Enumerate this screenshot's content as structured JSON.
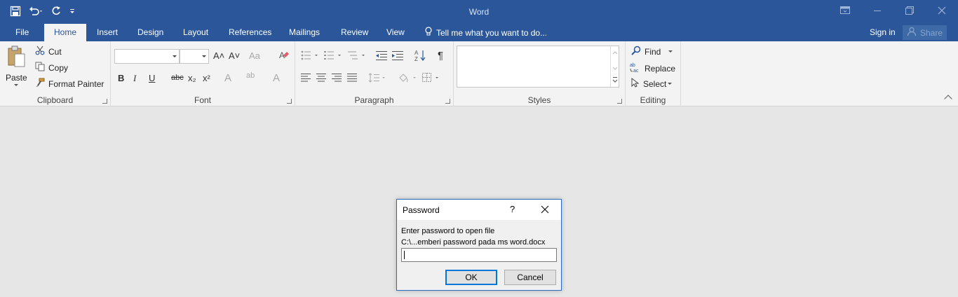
{
  "app": {
    "title": "Word"
  },
  "quick_access": {
    "icons": [
      "save-icon",
      "undo-icon",
      "redo-icon",
      "customize-icon"
    ]
  },
  "window_controls": {
    "icons": [
      "ribbon-display-icon",
      "minimize-icon",
      "restore-icon",
      "close-icon"
    ]
  },
  "tabs": [
    {
      "label": "File"
    },
    {
      "label": "Home"
    },
    {
      "label": "Insert"
    },
    {
      "label": "Design"
    },
    {
      "label": "Layout"
    },
    {
      "label": "References"
    },
    {
      "label": "Mailings"
    },
    {
      "label": "Review"
    },
    {
      "label": "View"
    }
  ],
  "active_tab": "Home",
  "tell_me": {
    "text": "Tell me what you want to do..."
  },
  "account": {
    "sign_in": "Sign in",
    "share": "Share"
  },
  "ribbon": {
    "clipboard": {
      "paste": "Paste",
      "cut": "Cut",
      "copy": "Copy",
      "format_painter": "Format Painter",
      "label": "Clipboard"
    },
    "font": {
      "label": "Font",
      "font_name": "",
      "font_size": "",
      "bold": "B",
      "italic": "I",
      "underline": "U",
      "strike": "abc",
      "subscript": "x₂",
      "superscript": "x²",
      "grow": "A˄",
      "shrink": "A˅",
      "case": "Aa",
      "text_effects": "A",
      "highlight": "ab",
      "font_color": "A"
    },
    "paragraph": {
      "label": "Paragraph",
      "pilcrow": "¶"
    },
    "styles": {
      "label": "Styles"
    },
    "editing": {
      "label": "Editing",
      "find": "Find",
      "replace": "Replace",
      "select": "Select"
    }
  },
  "dialog": {
    "title": "Password",
    "help": "?",
    "message_line1": "Enter password to open file",
    "message_line2": "C:\\...emberi password pada ms word.docx",
    "input_value": "",
    "ok": "OK",
    "cancel": "Cancel"
  },
  "colors": {
    "brand": "#2b579a",
    "ribbon_bg": "#f3f3f3",
    "workspace": "#e6e6e6",
    "dialog_focus": "#0078d7"
  }
}
